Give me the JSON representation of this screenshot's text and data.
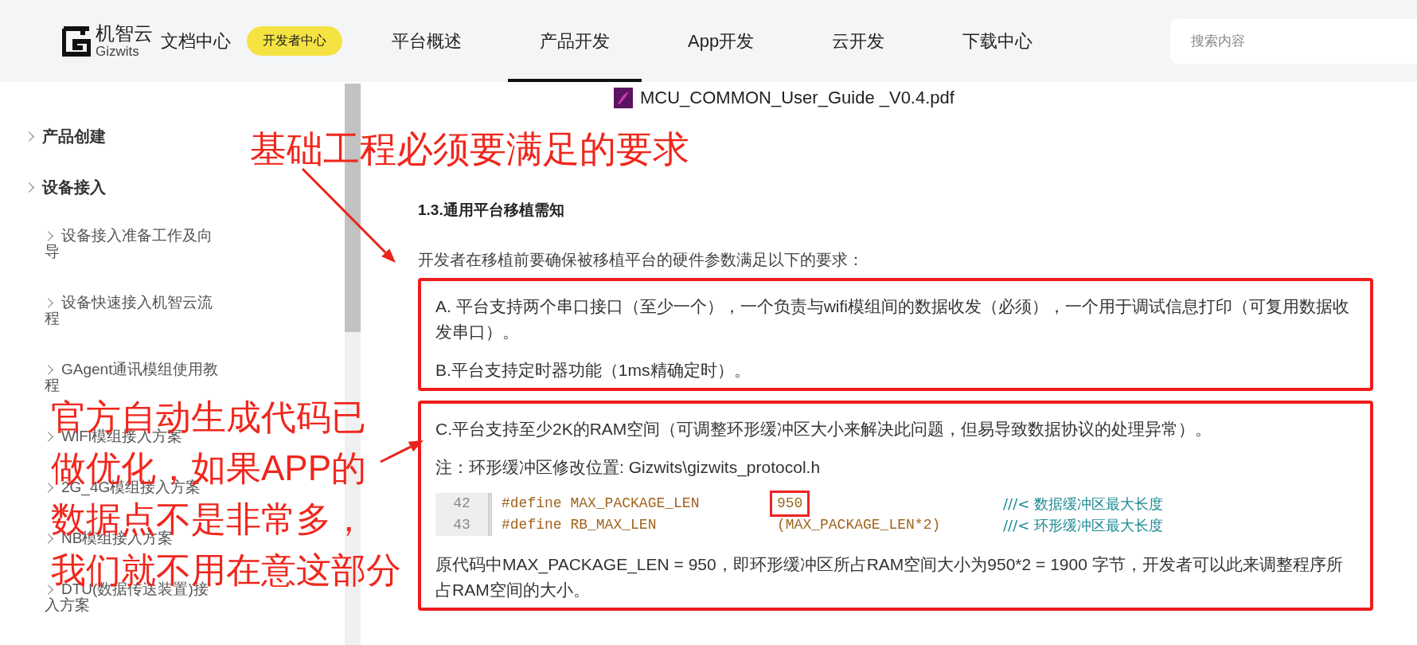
{
  "header": {
    "logo": {
      "name": "机智云",
      "sub": "Gizwits"
    },
    "site_title": "文档中心",
    "badge": "开发者中心",
    "nav": [
      {
        "label": "平台概述",
        "selected": false
      },
      {
        "label": "产品开发",
        "selected": true
      },
      {
        "label": "App开发",
        "selected": false
      },
      {
        "label": "云开发",
        "selected": false
      },
      {
        "label": "下载中心",
        "selected": false
      }
    ],
    "search": {
      "placeholder": "搜索内容"
    }
  },
  "sidebar": {
    "items": [
      {
        "label": "产品创建"
      },
      {
        "label": "设备接入",
        "children": [
          {
            "label": "设备接入准备工作及向导"
          },
          {
            "label": "设备快速接入机智云流程"
          },
          {
            "label": "GAgent通讯模组使用教程"
          },
          {
            "label": "WiFi模组接入方案"
          },
          {
            "label": "2G_4G模组接入方案"
          },
          {
            "label": "NB模组接入方案"
          },
          {
            "label": "DTU(数据传送装置)接入方案"
          }
        ]
      }
    ]
  },
  "content": {
    "attachment": "MCU_COMMON_User_Guide _V0.4.pdf",
    "heading": "1.3.通用平台移植需知",
    "intro": "开发者在移植前要确保被移植平台的硬件参数满足以下的要求：",
    "boxes": [
      {
        "blocks": [
          {
            "kind": "text",
            "text": "A. 平台支持两个串口接口（至少一个），一个负责与wifi模组间的数据收发（必须），一个用于调试信息打印（可复用数据收发串口）。"
          },
          {
            "kind": "text",
            "text": "B.平台支持定时器功能（1ms精确定时）。"
          }
        ]
      },
      {
        "blocks": [
          {
            "kind": "text",
            "text": "C.平台支持至少2K的RAM空间（可调整环形缓冲区大小来解决此问题，但易导致数据协议的处理异常）。"
          },
          {
            "kind": "text",
            "text": "注：环形缓冲区修改位置: Gizwits\\gizwits_protocol.h"
          },
          {
            "kind": "code",
            "lines": [
              {
                "number": "42",
                "name": "#define MAX_PACKAGE_LEN",
                "value": "950",
                "marked": true,
                "comment": "///< 数据缓冲区最大长度"
              },
              {
                "number": "43",
                "name": "#define RB_MAX_LEN",
                "value": "(MAX_PACKAGE_LEN*2)",
                "marked": false,
                "comment": "///< 环形缓冲区最大长度"
              }
            ]
          },
          {
            "kind": "text",
            "text": "原代码中MAX_PACKAGE_LEN = 950，即环形缓冲区所占RAM空间大小为950*2 = 1900 字节，开发者可以此来调整程序所占RAM空间的大小。"
          }
        ]
      }
    ]
  },
  "annotations": [
    {
      "lines": [
        "基础工程必须要满足的要求"
      ]
    },
    {
      "lines": [
        "官方自动生成代码已",
        "做优化，如果APP的",
        "数据点不是非常多，",
        "我们就不用在意这部分"
      ]
    }
  ]
}
